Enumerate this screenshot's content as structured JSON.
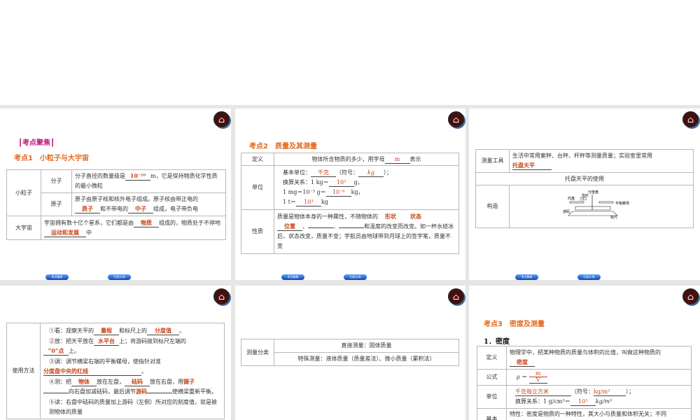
{
  "nav": {
    "prev": "考点聚焦",
    "next": "归类示例"
  },
  "icons": {
    "home": "home-icon"
  },
  "s1": {
    "focus": "┃考点聚焦┃",
    "title": "考点1　小粒子与大宇宙",
    "small": "小粒子",
    "mol": "分子",
    "mol_t1": "分子直径的数量级是",
    "mol_a": "10⁻¹⁰",
    "mol_t2": "m，它是保持物质化学性质的最小微粒",
    "atom": "原子",
    "atom_t1": "原子由原子核和核外电子组成。原子核由带正电的",
    "atom_a1": "质子",
    "atom_t2": "和不带电的",
    "atom_a2": "中子",
    "atom_t3": "组成，电子带负电",
    "big": "大宇宙",
    "uni_t1": "宇宙拥有数十亿个星系，它们都是由",
    "uni_a1": "物质",
    "uni_t2": "组成的，物质处于不停地",
    "uni_a2": "运动和发展",
    "uni_t3": "中"
  },
  "s2": {
    "title": "考点2　质量及其测量",
    "def": "定义",
    "def_t1": "物体所含物质的多少，用字母",
    "def_a": "m",
    "def_t2": "表示",
    "unit": "单位",
    "u1": "基本单位：",
    "u1a": "千克",
    "u1b": "（符号：",
    "u1c": "kg",
    "u1d": "）；",
    "u2": "换算关系：1 kg＝",
    "u2a": "10³",
    "u2b": "g，",
    "u3": "1 mg＝10⁻³ g＝",
    "u3a": "10⁻⁶",
    "u3b": "kg，",
    "u4": "1 t＝",
    "u4a": "10³",
    "u4b": "kg",
    "prop": "性质",
    "p1": "质量是物体本身的一种属性，不随物体的",
    "pa1": "形状",
    "pa2": "状态",
    "pa3": "位置",
    "p2": "、",
    "p3": "、",
    "p4": "和温度的改变而改变。如一杯水结冰后，状态改变，质量不变；宇航员由地球带到月球上的签字笔，质量不变"
  },
  "s3": {
    "tool": "测量工具",
    "tool_t": "生活中常用案秤、台秤、杆秤等测量质量；实验室里常用",
    "tool_a": "托盘天平",
    "use": "托盘天平的使用",
    "struct": "构造",
    "labels": {
      "dial": "分度盘",
      "pointer": "指针",
      "pan": "托盘",
      "knife": "刀口",
      "nut": "平衡螺母",
      "rider": "游码",
      "scale": "标尺"
    }
  },
  "s4": {
    "method": "使用方法",
    "l1a": "①看：观察天平的",
    "l1b": "量程",
    "l1c": "和标尺上的",
    "l1d": "分度值",
    "l1e": "。",
    "l2a": "②放：把天平放在",
    "l2b": "水平台",
    "l2c": "上；将游码拨到标尺左端的",
    "l2d": "“0”点",
    "l2e": "上。",
    "l3a": "③调：调节横梁右端的平衡螺母，使指针对准",
    "l3b": "分度盘中央的红线",
    "l3c": "。",
    "l4a": "④测：把",
    "l4b": "物体",
    "l4c": "放在左盘，",
    "l4d": "砝码",
    "l4e": "放在右盘，用",
    "l4f": "镊子",
    "l4g": "向右盘加减砝码，最后调节",
    "l4h": "游码",
    "l4i": "使横梁重新平衡。",
    "l5": "⑤读：右盘中砝码的质量加上游码（左侧）所对应的刻度值，就是被测物体的质量"
  },
  "s5": {
    "cat": "测量分类",
    "r1": "直接测量：固体质量",
    "r2": "特殊测量：液体质量（质量差法）、微小质量（累积法）"
  },
  "s6": {
    "title": "考点3　密度及测量",
    "sub": "1．密度",
    "def": "定义",
    "def_t": "物理学中，把某种物质的质量与体积的比值，叫做这种物质的",
    "def_a": "密度",
    "formula": "公式",
    "f1": "ρ ＝",
    "fm": "m",
    "fv": "V",
    "unit": "单位",
    "u1a": "千克每立方米",
    "u1b": "（符号：",
    "u1c": "kg/m³",
    "u1d": "）；",
    "u2": "换算关系：1 g/cm³＝",
    "u2a": "10³",
    "u2b": "kg/m³",
    "basic": "基本",
    "basic_t": "特性：密度是物质的一种特性，其大小与质量和体积无关；不同"
  }
}
